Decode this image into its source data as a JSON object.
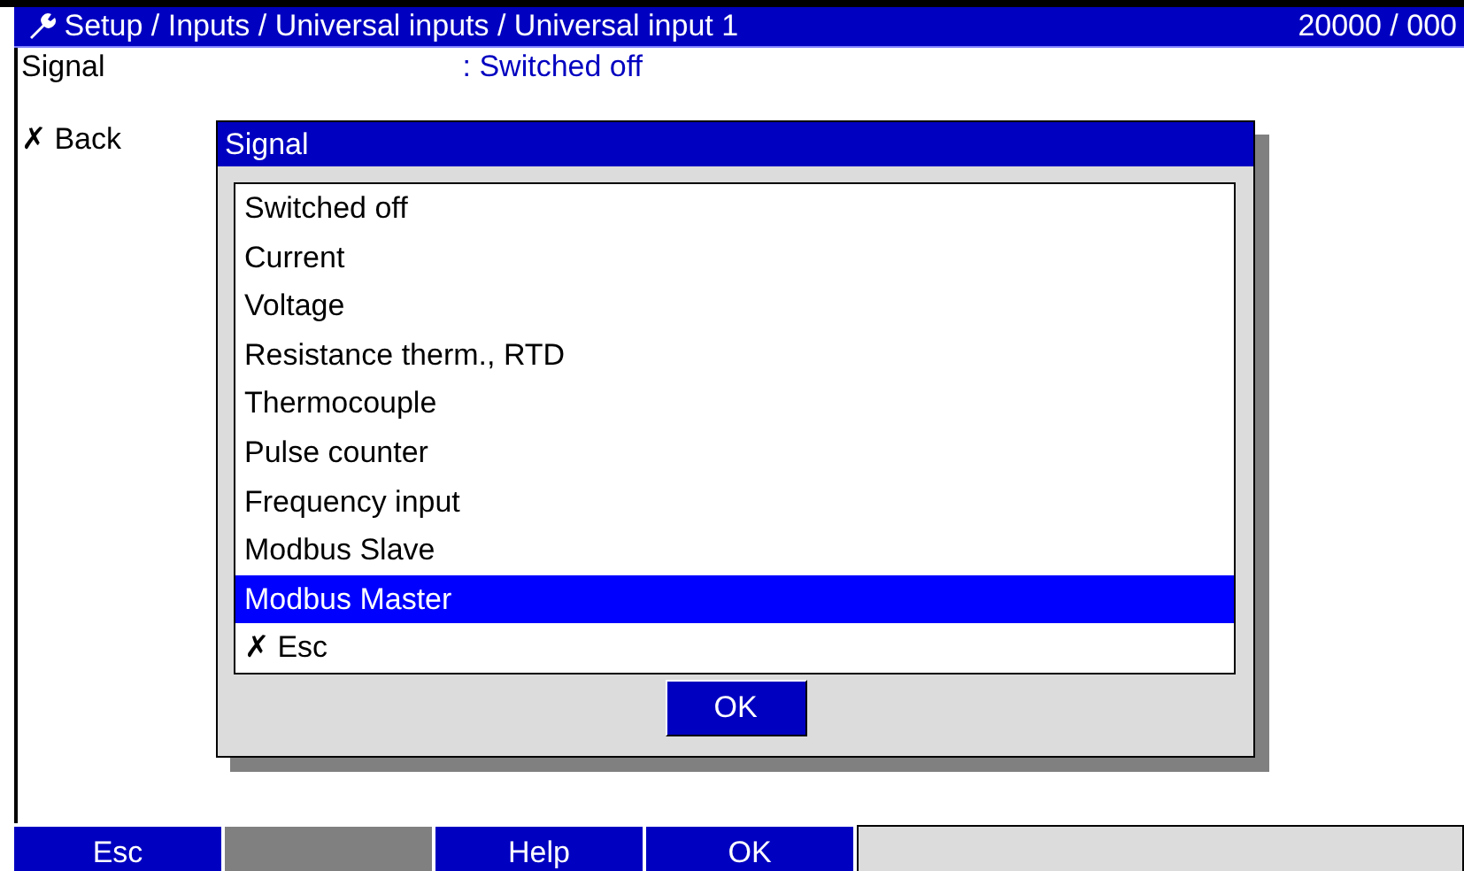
{
  "title_bar": {
    "path": "Setup / Inputs / Universal inputs / Universal input 1",
    "code": "20000 / 000"
  },
  "settings": [
    {
      "label": "Signal",
      "value": ": Switched off"
    }
  ],
  "back": "✗ Back",
  "dialog": {
    "title": "Signal",
    "options": [
      {
        "label": "Switched off",
        "selected": false
      },
      {
        "label": "Current",
        "selected": false
      },
      {
        "label": "Voltage",
        "selected": false
      },
      {
        "label": "Resistance therm., RTD",
        "selected": false
      },
      {
        "label": "Thermocouple",
        "selected": false
      },
      {
        "label": "Pulse counter",
        "selected": false
      },
      {
        "label": "Frequency input",
        "selected": false
      },
      {
        "label": "Modbus Slave",
        "selected": false
      },
      {
        "label": "Modbus Master",
        "selected": true
      },
      {
        "label": "✗ Esc",
        "selected": false
      }
    ],
    "ok": "OK"
  },
  "softkeys": [
    {
      "label": "Esc",
      "disabled": false
    },
    {
      "disabled": true
    },
    {
      "label": "Help",
      "disabled": false
    },
    {
      "label": "OK",
      "disabled": false
    }
  ]
}
